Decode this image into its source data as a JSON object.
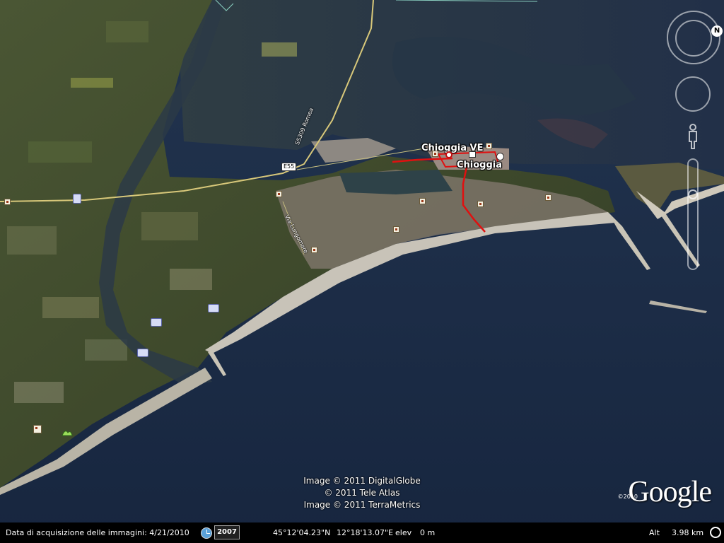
{
  "map": {
    "places": {
      "chioggia_ve": "Chioggia VE",
      "chioggia": "Chioggia"
    },
    "roads": {
      "e55": "E55",
      "ss_romea": "SS309 Romea",
      "via_lungomare": "Via Lungomare"
    },
    "icons": {
      "poi": "poi-square-icon",
      "hotel": "hotel-icon",
      "park": "park-icon",
      "pegman": "pegman-icon",
      "north": "north-icon",
      "clock": "historical-imagery-clock-icon"
    }
  },
  "copyright": {
    "line1": "Image © 2011 DigitalGlobe",
    "line2": "© 2011 Tele Atlas",
    "line3": "Image © 2011 TerraMetrics"
  },
  "brand": {
    "name": "Google",
    "year": "©2010"
  },
  "nav": {
    "north_label": "N"
  },
  "status": {
    "acquisition": "Data di acquisizione delle immagini: 4/21/2010",
    "year_button": "2007",
    "lat": "45°12'04.23\"N",
    "lon": "12°18'13.07\"E",
    "elev_label": "elev",
    "elev_value": "0 m",
    "alt_label": "Alt",
    "alt_value": "3.98 km"
  },
  "colors": {
    "sea": "#1d2f4d",
    "lagoon": "#2b3a4a",
    "land": "#3e4a2a",
    "town": "#8a7d72",
    "route": "#e01010",
    "road": "#d8c87a"
  }
}
